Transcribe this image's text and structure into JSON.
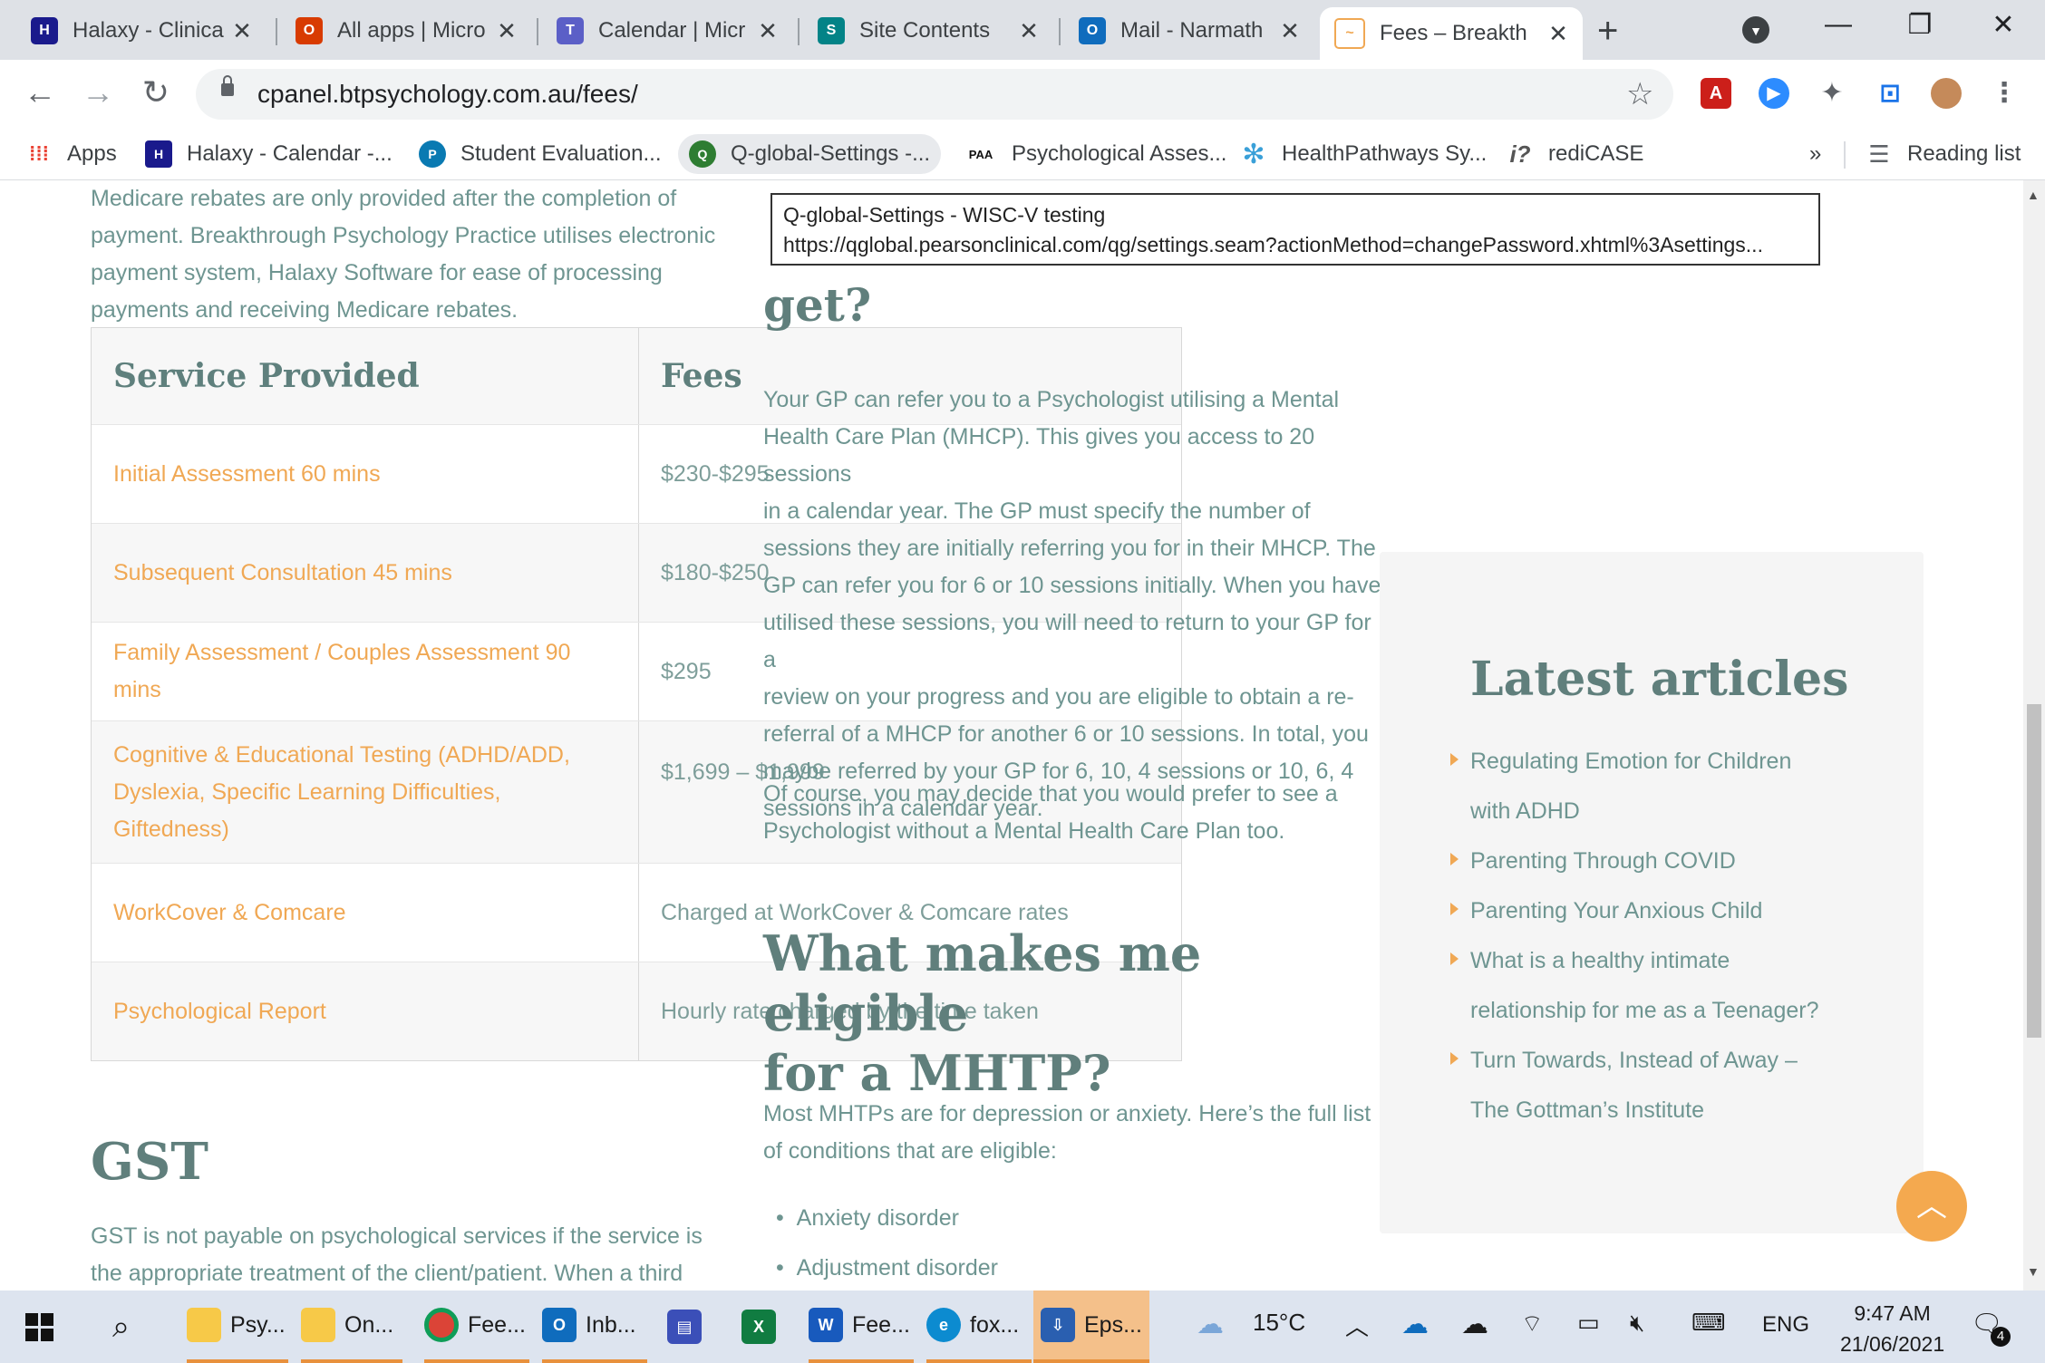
{
  "browser": {
    "tabs": [
      {
        "title": "Halaxy - Clinica",
        "icon": "halaxy-icon",
        "color": "#1a1a8c"
      },
      {
        "title": "All apps | Micro",
        "icon": "office-icon",
        "color": "#d83b01"
      },
      {
        "title": "Calendar | Micr",
        "icon": "teams-icon",
        "color": "#5b5fc7"
      },
      {
        "title": "Site Contents",
        "icon": "sharepoint-icon",
        "color": "#038387"
      },
      {
        "title": "Mail - Narmath",
        "icon": "outlook-icon",
        "color": "#0f6cbd"
      },
      {
        "title": "Fees – Breakth",
        "icon": "breakthrough-icon",
        "color": "#f0a854"
      }
    ],
    "new_tab": "+",
    "url": "cpanel.btpsychology.com.au/fees/",
    "bookmarks": [
      {
        "label": "Apps",
        "icon": "apps-grid-icon"
      },
      {
        "label": "Halaxy - Calendar -...",
        "icon": "halaxy-icon"
      },
      {
        "label": "Student Evaluation...",
        "icon": "pearson-icon"
      },
      {
        "label": "Q-global-Settings -...",
        "icon": "qglobal-icon"
      },
      {
        "label": "Psychological Asses...",
        "icon": "paa-icon"
      },
      {
        "label": "HealthPathways Sy...",
        "icon": "healthpathways-icon"
      },
      {
        "label": "rediCASE",
        "icon": "redicase-icon"
      }
    ],
    "bookmarks_overflow": "»",
    "reading_list": "Reading list"
  },
  "tooltip": {
    "title": "Q-global-Settings - WISC-V testing",
    "url": "https://qglobal.pearsonclinical.com/qg/settings.seam?actionMethod=changePassword.xhtml%3Asettings..."
  },
  "page": {
    "intro": [
      "Medicare rebates are only provided after the completion of",
      "payment. Breakthrough Psychology Practice utilises electronic",
      "payment system, Halaxy Software for ease of processing",
      "payments and receiving Medicare rebates."
    ],
    "fees_table": {
      "headers": {
        "service": "Service Provided",
        "fees": "Fees"
      },
      "rows": [
        {
          "service": "Initial Assessment 60 mins",
          "fee": "$230-$295"
        },
        {
          "service": "Subsequent Consultation 45 mins",
          "fee": "$180-$250"
        },
        {
          "service": "Family Assessment / Couples Assessment 90 mins",
          "fee": "$295"
        },
        {
          "service": "Cognitive & Educational Testing (ADHD/ADD, Dyslexia, Specific Learning Difficulties, Giftedness)",
          "fee": "$1,699 – $1,999"
        },
        {
          "service": "WorkCover & Comcare",
          "fee": "Charged at WorkCover & Comcare rates"
        },
        {
          "service": "Psychological Report",
          "fee": "Hourly rate charged by the time taken"
        }
      ]
    },
    "gst_heading": "GST",
    "gst_text": [
      "GST is not payable on psychological services if the service is",
      "the appropriate treatment of the client/patient. When a third"
    ],
    "sessions_heading_partial": "get?",
    "sessions_text": [
      "Your GP can refer you to a Psychologist utilising a Mental",
      "Health Care Plan (MHCP). This gives you access to 20 sessions",
      "in a calendar year. The GP must specify the number of",
      "sessions they are initially referring you for in their MHCP. The",
      "GP can refer you for 6 or 10 sessions initially. When you have",
      "utilised these sessions, you will need to return to your GP for a",
      "review on your progress and you are eligible to obtain a re-",
      "referral of a MHCP for another 6 or 10 sessions. In total, you",
      "maybe referred by your GP for 6, 10, 4 sessions or 10, 6, 4",
      "sessions in a calendar year."
    ],
    "sessions_text2": [
      "Of course, you may decide that you would prefer to see a",
      "Psychologist without a Mental Health Care Plan too."
    ],
    "eligible_heading": [
      "What makes me eligible",
      "for a MHTP?"
    ],
    "eligible_text": [
      "Most MHTPs are for depression or anxiety. Here’s the full list",
      "of conditions that are eligible:"
    ],
    "conditions": [
      "Anxiety disorder",
      "Adjustment disorder"
    ]
  },
  "sidebar": {
    "heading": "Latest articles",
    "articles": [
      [
        "Regulating Emotion for Children",
        "with ADHD"
      ],
      [
        "Parenting Through COVID"
      ],
      [
        "Parenting Your Anxious Child"
      ],
      [
        "What is a healthy intimate",
        "relationship for me as a Teenager?"
      ],
      [
        "Turn Towards, Instead of Away –",
        "The Gottman’s Institute"
      ]
    ]
  },
  "taskbar": {
    "apps": [
      {
        "label": "Psy...",
        "icon": "folder-icon"
      },
      {
        "label": "On...",
        "icon": "folder-icon"
      },
      {
        "label": "Fee...",
        "icon": "chrome-icon"
      },
      {
        "label": "Inb...",
        "icon": "outlook-icon"
      },
      {
        "label": "",
        "icon": "printer-icon"
      },
      {
        "label": "",
        "icon": "excel-icon"
      },
      {
        "label": "Fee...",
        "icon": "word-icon"
      },
      {
        "label": "fox...",
        "icon": "edge-icon"
      },
      {
        "label": "Eps...",
        "icon": "epson-scan-icon"
      }
    ],
    "weather": "15°C",
    "language": "ENG",
    "time": "9:47 AM",
    "date": "21/06/2021",
    "notifications": "4"
  }
}
